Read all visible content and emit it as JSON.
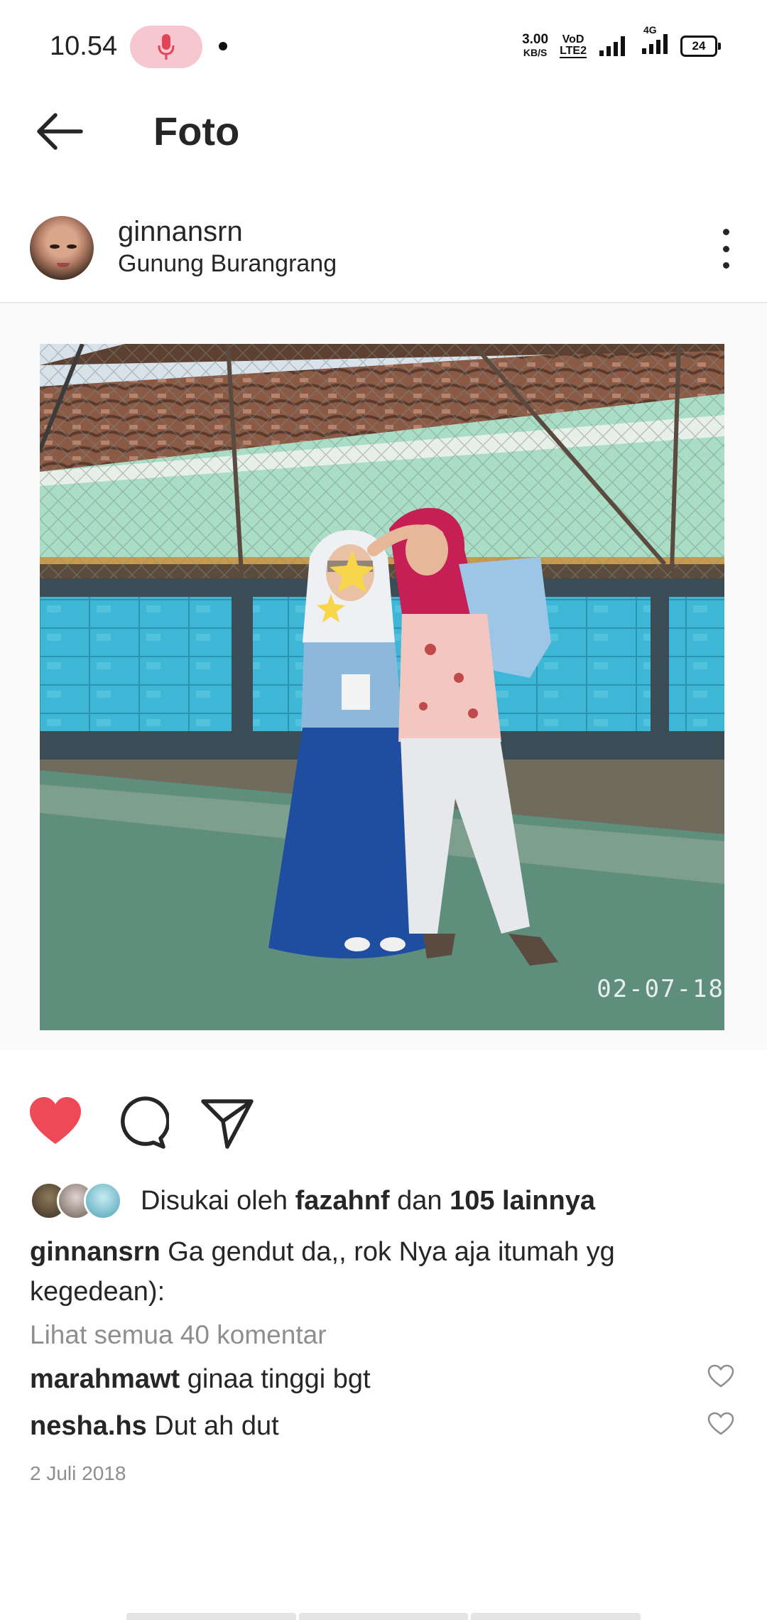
{
  "status_bar": {
    "time": "10.54",
    "speed_value": "3.00",
    "speed_unit": "KB/S",
    "volte_top": "VoD",
    "volte_bottom": "LTE2",
    "network": "4G",
    "battery": "24"
  },
  "header": {
    "title": "Foto"
  },
  "post": {
    "username": "ginnansrn",
    "location": "Gunung Burangrang",
    "photo_date_stamp": "02-07-18",
    "liked": true,
    "likes_prefix": "Disukai oleh",
    "likes_user": "fazahnf",
    "likes_connector": "dan",
    "likes_others": "105 lainnya",
    "caption_user": "ginnansrn",
    "caption_text": "Ga gendut da,, rok Nya aja itumah yg kegedean):",
    "view_all_comments": "Lihat semua 40 komentar",
    "comments": [
      {
        "user": "marahmawt",
        "text": "ginaa tinggi bgt"
      },
      {
        "user": "nesha.hs",
        "text": "Dut ah dut"
      }
    ],
    "date": "2 Juli 2018"
  },
  "colors": {
    "like_red": "#ed4956",
    "muted_grey": "#8e8e8e",
    "mic_pill": "#f6c7cf"
  }
}
